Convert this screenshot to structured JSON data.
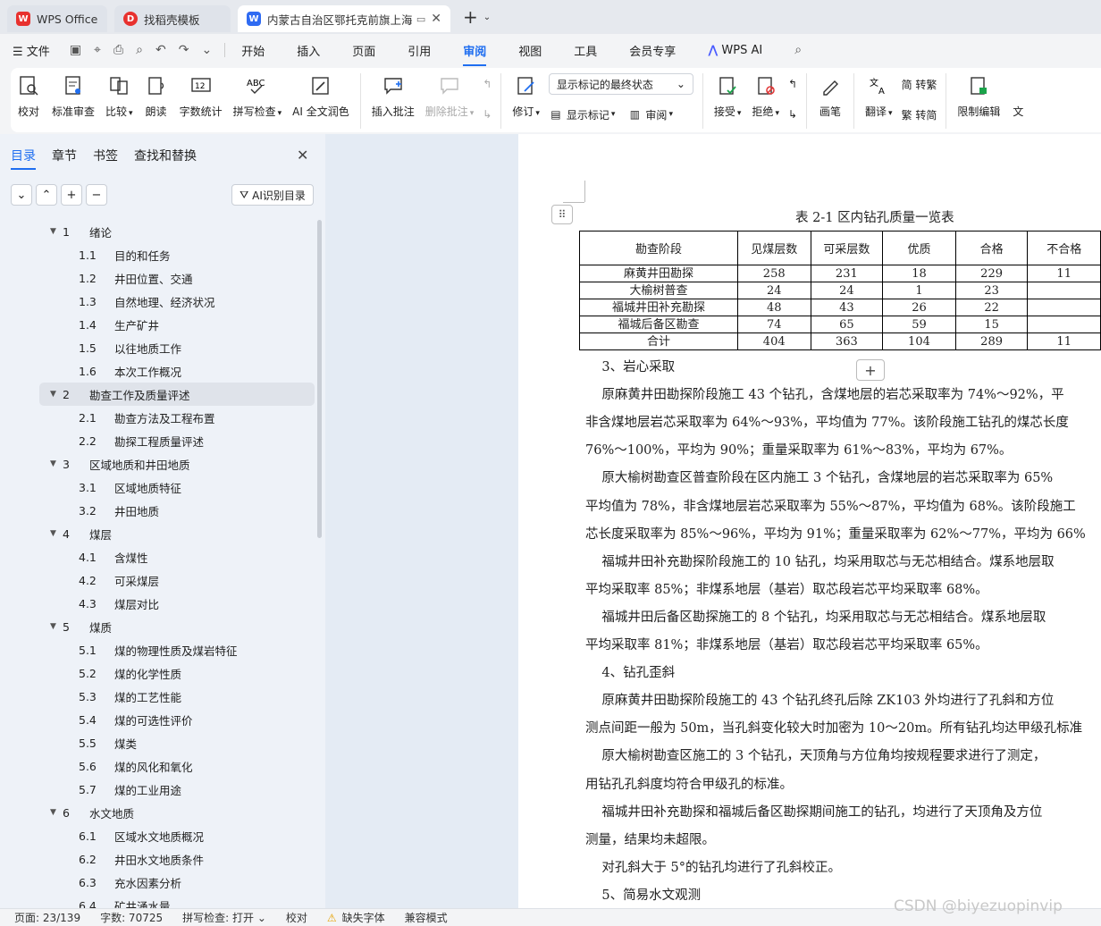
{
  "tabs": {
    "wps": "WPS Office",
    "template": "找稻壳模板",
    "document": "内蒙古自治区鄂托克前旗上海"
  },
  "menubar": {
    "file": "文件",
    "items": [
      "开始",
      "插入",
      "页面",
      "引用",
      "审阅",
      "视图",
      "工具",
      "会员专享"
    ],
    "active": "审阅",
    "ai": "WPS AI"
  },
  "ribbon": {
    "proofread": "校对",
    "standard_review": "标准审查",
    "compare": "比较",
    "read_aloud": "朗读",
    "word_count": "字数统计",
    "spell_check": "拼写检查",
    "ai_polish": "AI 全文润色",
    "insert_comment": "插入批注",
    "delete_comment": "删除批注",
    "revise": "修订",
    "markup_dropdown": "显示标记的最终状态",
    "show_markup": "显示标记",
    "review": "审阅",
    "accept": "接受",
    "reject": "拒绝",
    "pen": "画笔",
    "translate": "翻译",
    "to_traditional": "简 转繁",
    "to_simplified": "繁 转简",
    "restrict_edit": "限制编辑",
    "cut_label": "文"
  },
  "navpane": {
    "tabs": [
      "目录",
      "章节",
      "书签",
      "查找和替换"
    ],
    "ai_toc": "AI识别目录",
    "toc": [
      {
        "num": "1",
        "title": "绪论",
        "level": 1
      },
      {
        "num": "1.1",
        "title": "目的和任务",
        "level": 2
      },
      {
        "num": "1.2",
        "title": "井田位置、交通",
        "level": 2
      },
      {
        "num": "1.3",
        "title": "自然地理、经济状况",
        "level": 2
      },
      {
        "num": "1.4",
        "title": "生产矿井",
        "level": 2
      },
      {
        "num": "1.5",
        "title": "以往地质工作",
        "level": 2
      },
      {
        "num": "1.6",
        "title": "本次工作概况",
        "level": 2
      },
      {
        "num": "2",
        "title": "勘查工作及质量评述",
        "level": 1
      },
      {
        "num": "2.1",
        "title": "勘查方法及工程布置",
        "level": 2
      },
      {
        "num": "2.2",
        "title": "勘探工程质量评述",
        "level": 2
      },
      {
        "num": "3",
        "title": "区域地质和井田地质",
        "level": 1
      },
      {
        "num": "3.1",
        "title": "区域地质特征",
        "level": 2
      },
      {
        "num": "3.2",
        "title": "井田地质",
        "level": 2
      },
      {
        "num": "4",
        "title": "煤层",
        "level": 1
      },
      {
        "num": "4.1",
        "title": "含煤性",
        "level": 2
      },
      {
        "num": "4.2",
        "title": "可采煤层",
        "level": 2
      },
      {
        "num": "4.3",
        "title": "煤层对比",
        "level": 2
      },
      {
        "num": "5",
        "title": "煤质",
        "level": 1
      },
      {
        "num": "5.1",
        "title": "煤的物理性质及煤岩特征",
        "level": 2
      },
      {
        "num": "5.2",
        "title": "煤的化学性质",
        "level": 2
      },
      {
        "num": "5.3",
        "title": "煤的工艺性能",
        "level": 2
      },
      {
        "num": "5.4",
        "title": "煤的可选性评价",
        "level": 2
      },
      {
        "num": "5.5",
        "title": "煤类",
        "level": 2
      },
      {
        "num": "5.6",
        "title": "煤的风化和氧化",
        "level": 2
      },
      {
        "num": "5.7",
        "title": "煤的工业用途",
        "level": 2
      },
      {
        "num": "6",
        "title": "水文地质",
        "level": 1
      },
      {
        "num": "6.1",
        "title": "区域水文地质概况",
        "level": 2
      },
      {
        "num": "6.2",
        "title": "井田水文地质条件",
        "level": 2
      },
      {
        "num": "6.3",
        "title": "充水因素分析",
        "level": 2
      },
      {
        "num": "6.4",
        "title": "矿井涌水量",
        "level": 2
      }
    ],
    "selected": 7
  },
  "document": {
    "table_caption": "表 2-1   区内钻孔质量一览表",
    "table_headers": [
      "勘查阶段",
      "见煤层数",
      "可采层数",
      "优质",
      "合格",
      "不合格"
    ],
    "table_rows": [
      [
        "麻黄井田勘探",
        "258",
        "231",
        "18",
        "229",
        "11"
      ],
      [
        "大榆树普查",
        "24",
        "24",
        "1",
        "23",
        ""
      ],
      [
        "福城井田补充勘探",
        "48",
        "43",
        "26",
        "22",
        ""
      ],
      [
        "福城后备区勘查",
        "74",
        "65",
        "59",
        "15",
        ""
      ],
      [
        "合计",
        "404",
        "363",
        "104",
        "289",
        "11"
      ]
    ],
    "paragraphs": [
      "    3、岩心采取",
      "    原麻黄井田勘探阶段施工 43 个钻孔，含煤地层的岩芯采取率为 74%～92%，平",
      "非含煤地层岩芯采取率为 64%～93%，平均值为 77%。该阶段施工钻孔的煤芯长度",
      "76%～100%，平均为 90%；重量采取率为 61%～83%，平均为 67%。",
      "    原大榆树勘查区普查阶段在区内施工 3 个钻孔，含煤地层的岩芯采取率为 65%",
      "平均值为 78%，非含煤地层岩芯采取率为 55%～87%，平均值为 68%。该阶段施工",
      "芯长度采取率为 85%～96%，平均为 91%；重量采取率为 62%～77%，平均为 66%",
      "    福城井田补充勘探阶段施工的 10 钻孔，均采用取芯与无芯相结合。煤系地层取",
      "平均采取率 85%；非煤系地层（基岩）取芯段岩芯平均采取率 68%。",
      "    福城井田后备区勘探施工的 8 个钻孔，均采用取芯与无芯相结合。煤系地层取",
      "平均采取率 81%；非煤系地层（基岩）取芯段岩芯平均采取率 65%。",
      "    4、钻孔歪斜",
      "    原麻黄井田勘探阶段施工的 43 个钻孔终孔后除 ZK103 外均进行了孔斜和方位",
      "测点间距一般为 50m，当孔斜变化较大时加密为 10～20m。所有钻孔均达甲级孔标准",
      "    原大榆树勘查区施工的 3 个钻孔，天顶角与方位角均按规程要求进行了测定，",
      "用钻孔孔斜度均符合甲级孔的标准。",
      "    福城井田补充勘探和福城后备区勘探期间施工的钻孔，均进行了天顶角及方位",
      "测量，结果均未超限。",
      "    对孔斜大于 5°的钻孔均进行了孔斜校正。",
      "    5、简易水文观测"
    ]
  },
  "statusbar": {
    "page": "页面: 23/139",
    "words": "字数: 70725",
    "spell": "拼写检查: 打开",
    "proof": "校对",
    "missing_font": "缺失字体",
    "compat": "兼容模式"
  },
  "watermark": "CSDN @biyezuopinvip"
}
